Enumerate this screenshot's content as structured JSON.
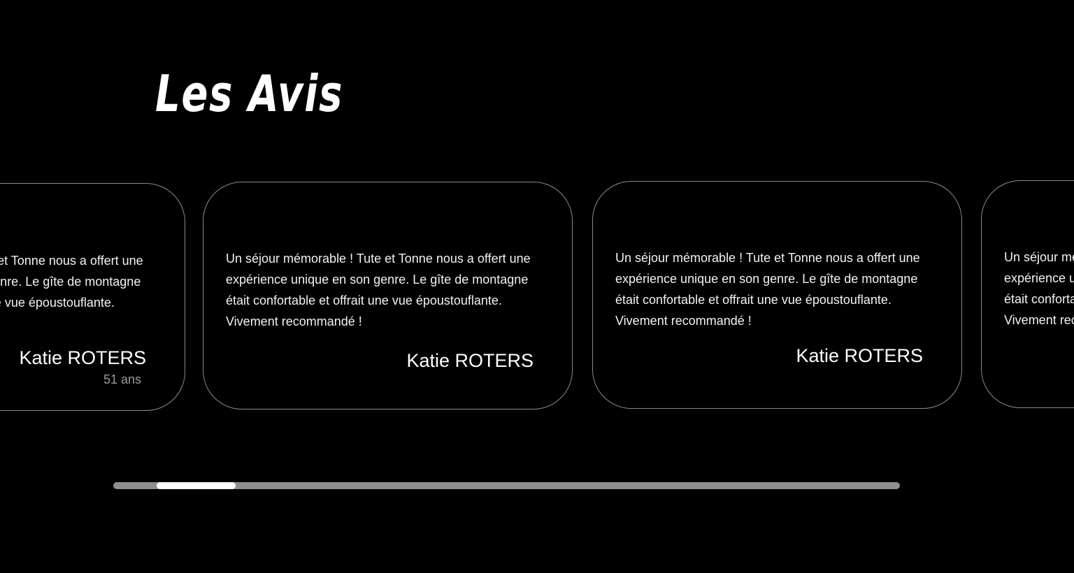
{
  "section": {
    "title": "Les Avis"
  },
  "reviews": [
    {
      "text": "Un séjour mémorable ! Tute et Tonne nous a offert une expérience unique en son genre. Le gîte de montagne était confortable et offrait une vue époustouflante. Vivement recommandé !",
      "author": "Katie ROTERS",
      "age": "51 ans"
    },
    {
      "text": "Un séjour mémorable ! Tute et Tonne nous a offert une expérience unique en son genre. Le gîte de montagne était confortable et offrait une vue époustouflante. Vivement recommandé !",
      "author": "Katie ROTERS"
    },
    {
      "text": "Un séjour mémorable ! Tute et Tonne nous a offert une expérience unique en son genre. Le gîte de montagne était confortable et offrait une vue époustouflante. Vivement recommandé !",
      "author": "Katie ROTERS"
    },
    {
      "text": "Un séjour mémorable ! Tute et Tonne nous a offert une expérience unique en son genre. Le gîte de montagne était confortable et offrait une vue époustouflante. Vivement recommandé !"
    }
  ],
  "scrollbar": {
    "position_fraction": 0.055,
    "visible_fraction": 0.1
  },
  "colors": {
    "background": "#000000",
    "text": "#ffffff",
    "card_border": "#8a8a8a",
    "muted_text": "#9a9a9a",
    "track": "#8f8f8f",
    "thumb": "#ffffff"
  }
}
